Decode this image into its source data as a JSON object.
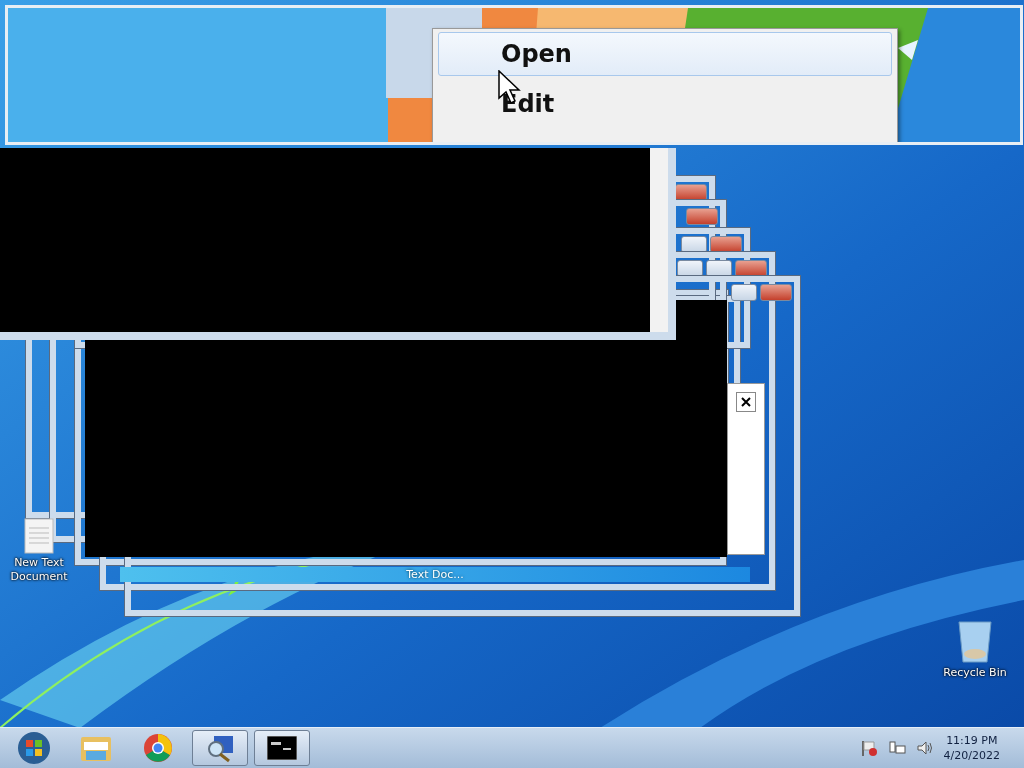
{
  "preview": {
    "menu": [
      {
        "label": "Open",
        "selected": true
      },
      {
        "label": "Edit",
        "selected": false
      }
    ]
  },
  "window_bar": {
    "title": "Text Doc..."
  },
  "desktop_icons": [
    {
      "kind": "document",
      "label": "New Text Document"
    },
    {
      "kind": "recycle",
      "label": "Recycle Bin"
    }
  ],
  "taskbar": {
    "items": [
      {
        "kind": "start",
        "running": false
      },
      {
        "kind": "explorer",
        "running": false
      },
      {
        "kind": "chrome",
        "running": false
      },
      {
        "kind": "magnifier",
        "running": true
      },
      {
        "kind": "console",
        "running": true
      }
    ],
    "clock": {
      "time": "11:19 PM",
      "date": "4/20/2022"
    }
  }
}
